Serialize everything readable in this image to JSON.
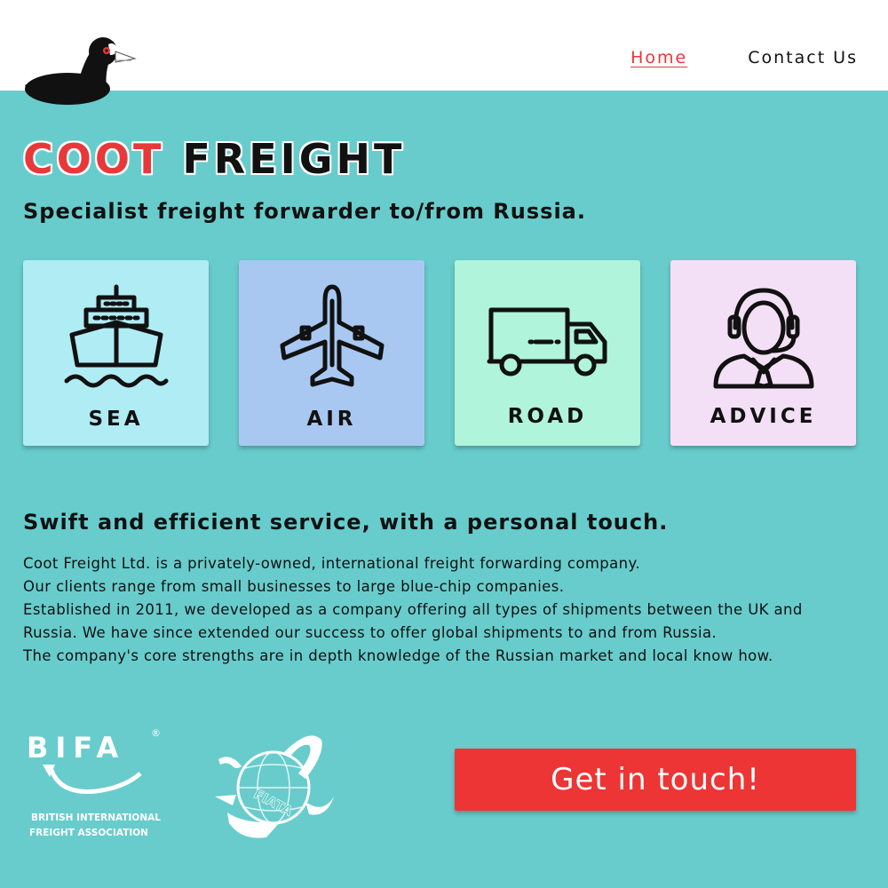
{
  "nav": {
    "home": "Home",
    "contact": "Contact Us"
  },
  "brand": {
    "coot": "COOT",
    "freight": "FREIGHT",
    "tagline": "Specialist freight forwarder to/from Russia."
  },
  "services": [
    {
      "label": "SEA",
      "color": "#b0ecf4",
      "icon": "ship-icon"
    },
    {
      "label": "AIR",
      "color": "#a8c8f2",
      "icon": "airplane-icon"
    },
    {
      "label": "ROAD",
      "color": "#b0f4dc",
      "icon": "truck-icon"
    },
    {
      "label": "ADVICE",
      "color": "#f4e0f6",
      "icon": "headset-agent-icon"
    }
  ],
  "about": {
    "heading": "Swift and efficient service, with a personal touch.",
    "lines": [
      "Coot Freight Ltd. is a privately-owned, international freight forwarding company.",
      "Our clients range from small businesses to large blue-chip companies.",
      "Established in 2011, we developed as a company offering all types of shipments between the UK and",
      "Russia. We have since extended our success to offer global shipments to and from Russia.",
      "The company's core strengths are in depth knowledge of the Russian market and local know how."
    ]
  },
  "logos": {
    "bifa": "BIFA",
    "bifa_registered": "®",
    "bifa_line1": "BRITISH INTERNATIONAL",
    "bifa_line2": "FREIGHT ASSOCIATION",
    "fiata": "FIATA"
  },
  "cta": {
    "label": "Get in touch!"
  },
  "colors": {
    "accent": "#e8383a",
    "background": "#68cccc",
    "button": "#ed3535"
  }
}
